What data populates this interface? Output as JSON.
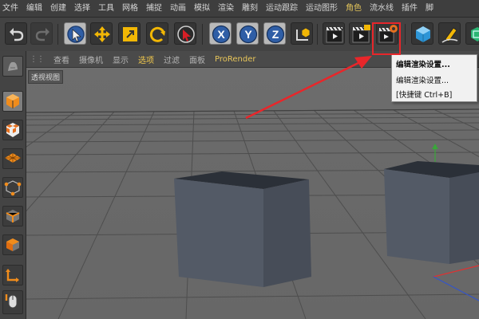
{
  "menu": {
    "items": [
      {
        "label": "文件"
      },
      {
        "label": "编辑"
      },
      {
        "label": "创建"
      },
      {
        "label": "选择"
      },
      {
        "label": "工具"
      },
      {
        "label": "网格"
      },
      {
        "label": "捕捉"
      },
      {
        "label": "动画"
      },
      {
        "label": "模拟"
      },
      {
        "label": "渲染"
      },
      {
        "label": "雕刻"
      },
      {
        "label": "运动跟踪"
      },
      {
        "label": "运动图形"
      },
      {
        "label": "角色"
      },
      {
        "label": "流水线"
      },
      {
        "label": "插件"
      },
      {
        "label": "脚"
      }
    ]
  },
  "viewport_menu": {
    "items": [
      {
        "label": "查看"
      },
      {
        "label": "摄像机"
      },
      {
        "label": "显示"
      },
      {
        "label": "选项"
      },
      {
        "label": "过滤"
      },
      {
        "label": "面板"
      },
      {
        "label": "ProRender"
      }
    ]
  },
  "viewport": {
    "label": "透视视图"
  },
  "dropdown": {
    "items": [
      {
        "label": "编辑渲染设置..."
      },
      {
        "label": "编辑渲染设置..."
      },
      {
        "label": "[快捷键 Ctrl+B]"
      }
    ]
  },
  "toolbar": {
    "icons": [
      "undo-icon",
      "redo-icon",
      "live-selection-icon",
      "move-icon",
      "scale-icon",
      "rotate-icon",
      "recent-tool-icon",
      "x-axis-icon",
      "y-axis-icon",
      "z-axis-icon",
      "coordinate-system-icon",
      "render-view-icon",
      "render-to-picture-viewer-icon",
      "edit-render-settings-icon",
      "cube-icon",
      "pen-icon",
      "subdivision-icon"
    ]
  },
  "sidebar": {
    "icons": [
      "model-mode-icon",
      "object-mode-icon",
      "texture-mode-icon",
      "workplane-icon",
      "points-mode-icon",
      "edges-mode-icon",
      "polygons-mode-icon",
      "axis-mode-icon",
      "tweak-mode-icon"
    ]
  },
  "colors": {
    "accent": "#f2c94c",
    "highlight_box": "#e8262a",
    "selected_menu": "#e0c25a"
  }
}
